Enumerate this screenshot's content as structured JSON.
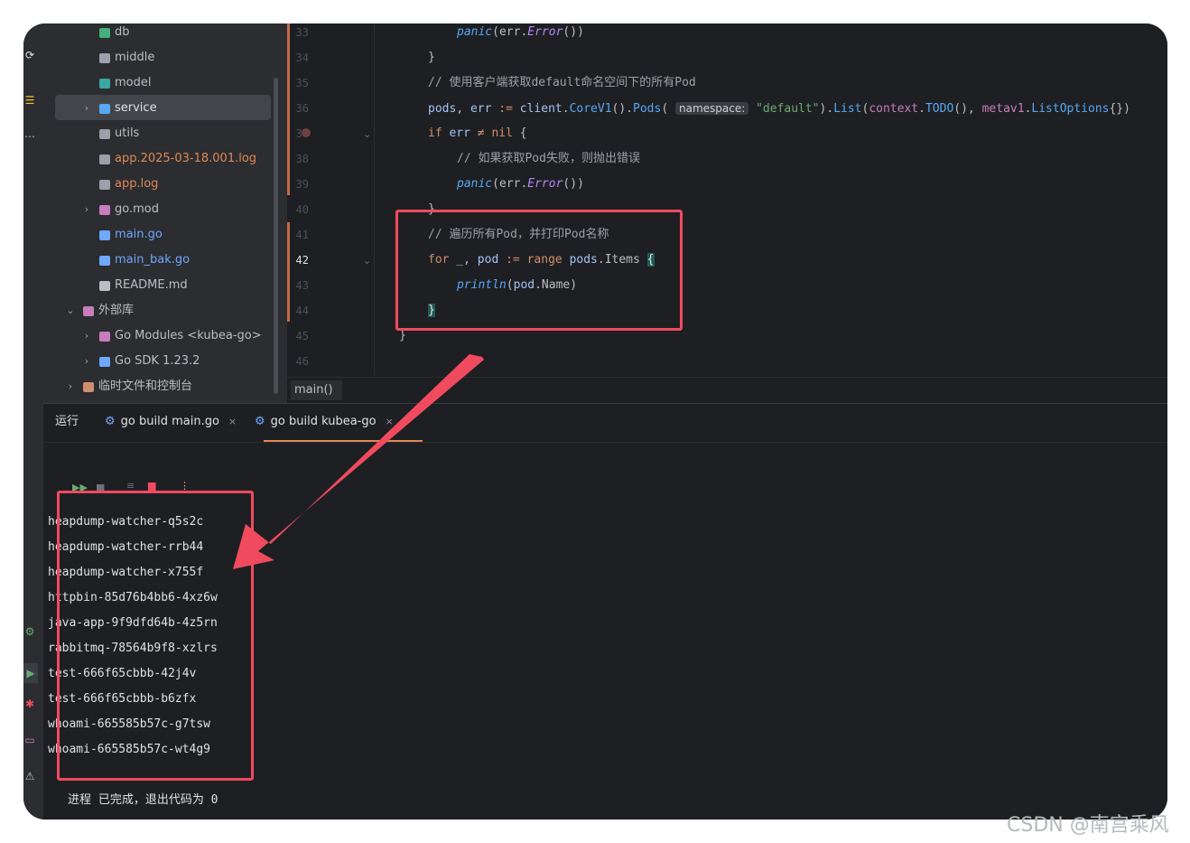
{
  "tree": {
    "items": [
      {
        "label": "db",
        "color": "#bcbec4"
      },
      {
        "label": "middle",
        "color": "#bcbec4"
      },
      {
        "label": "model",
        "color": "#bcbec4"
      },
      {
        "label": "service",
        "color": "#dfe1e5"
      },
      {
        "label": "utils",
        "color": "#bcbec4"
      },
      {
        "label": "app.2025-03-18.001.log",
        "color": "#e08855"
      },
      {
        "label": "app.log",
        "color": "#e08855"
      },
      {
        "label": "go.mod",
        "color": "#bcbec4"
      },
      {
        "label": "main.go",
        "color": "#6fa8ff"
      },
      {
        "label": "main_bak.go",
        "color": "#6fa8ff"
      },
      {
        "label": "README.md",
        "color": "#bcbec4"
      },
      {
        "label": "外部库",
        "color": "#bcbec4"
      },
      {
        "label": "Go Modules <kubea-go>",
        "color": "#bcbec4"
      },
      {
        "label": "Go SDK 1.23.2",
        "color": "#bcbec4"
      },
      {
        "label": "临时文件和控制台",
        "color": "#bcbec4"
      }
    ]
  },
  "editor": {
    "line_numbers": [
      "33",
      "34",
      "35",
      "36",
      "37",
      "38",
      "39",
      "40",
      "41",
      "42",
      "43",
      "44",
      "45",
      "46"
    ],
    "current_line": "42",
    "code": {
      "l33_fn": "panic",
      "l33_rest": "(err.",
      "l33_m": "Error",
      "l33_end": "())",
      "l34": "}",
      "l35": "// 使用客户端获取default命名空间下的所有Pod",
      "l36_a": "pods",
      "l36_b": ", ",
      "l36_c": "err",
      "l36_d": " := ",
      "l36_e": "client",
      "l36_f": ".",
      "l36_g": "CoreV1",
      "l36_h": "().",
      "l36_i": "Pods",
      "l36_j": "( ",
      "l36_hint": "namespace:",
      "l36_k": " ",
      "l36_str": "\"default\"",
      "l36_l": ").",
      "l36_m": "List",
      "l36_n": "(",
      "l36_o": "context",
      "l36_p": ".",
      "l36_q": "TODO",
      "l36_r": "(), ",
      "l36_s": "metav1",
      "l36_t": ".",
      "l36_u": "ListOptions",
      "l36_v": "{})",
      "l37_if": "if",
      "l37_err": " err ",
      "l37_ne": "≠",
      "l37_nil": " nil",
      "l37_br": " {",
      "l38": "// 如果获取Pod失败，则抛出错误",
      "l39_fn": "panic",
      "l39_rest": "(err.",
      "l39_m": "Error",
      "l39_end": "())",
      "l40": "}",
      "l41": "// 遍历所有Pod，并打印Pod名称",
      "l42_for": "for",
      "l42_a": " _, ",
      "l42_pod": "pod",
      "l42_b": " := ",
      "l42_range": "range",
      "l42_c": " ",
      "l42_pods": "pods",
      "l42_d": ".Items ",
      "l42_br": "{",
      "l43_fn": "println",
      "l43_a": "(",
      "l43_pod": "pod",
      "l43_b": ".Name)",
      "l44": "}",
      "l45": "}"
    },
    "breadcrumb": "main()"
  },
  "run": {
    "tabs": [
      {
        "label": "运行"
      },
      {
        "label": "go build main.go",
        "close": "×"
      },
      {
        "label": "go build kubea-go",
        "close": "×"
      }
    ],
    "output": [
      "heapdump-watcher-q5s2c",
      "heapdump-watcher-rrb44",
      "heapdump-watcher-x755f",
      "httpbin-85d76b4bb6-4xz6w",
      "java-app-9f9dfd64b-4z5rn",
      "rabbitmq-78564b9f8-xzlrs",
      "test-666f65cbbb-42j4v",
      "test-666f65cbbb-b6zfx",
      "whoami-665585b57c-g7tsw",
      "whoami-665585b57c-wt4g9"
    ],
    "exit_message": "进程 已完成，退出代码为 0"
  },
  "watermark": "CSDN @南宫乘风",
  "colors": {
    "highlight_box": "#f04a5e",
    "arrow": "#f04a5e"
  }
}
